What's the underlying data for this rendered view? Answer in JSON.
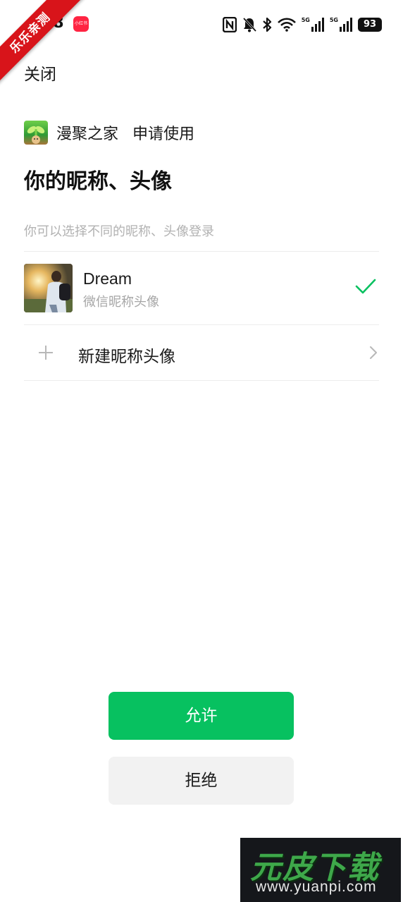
{
  "status_bar": {
    "time": "08",
    "app_badge": "小红书",
    "network_1": "5G",
    "network_2": "5G",
    "battery": "93"
  },
  "ribbon": "乐乐亲测",
  "header": {
    "close_label": "关闭",
    "app_name": "漫聚之家",
    "request_label": "申请使用"
  },
  "main": {
    "title": "你的昵称、头像",
    "hint": "你可以选择不同的昵称、头像登录",
    "current_profile": {
      "name": "Dream",
      "subtitle": "微信昵称头像",
      "selected": true
    },
    "new_profile_label": "新建昵称头像"
  },
  "actions": {
    "allow_label": "允许",
    "deny_label": "拒绝"
  },
  "watermark": {
    "brand": "元皮下载",
    "url": "www.yuanpi.com"
  },
  "colors": {
    "accent": "#07c160",
    "deny_bg": "#f2f2f2",
    "hint_text": "#b2b2b2",
    "ribbon": "#d8141a"
  }
}
